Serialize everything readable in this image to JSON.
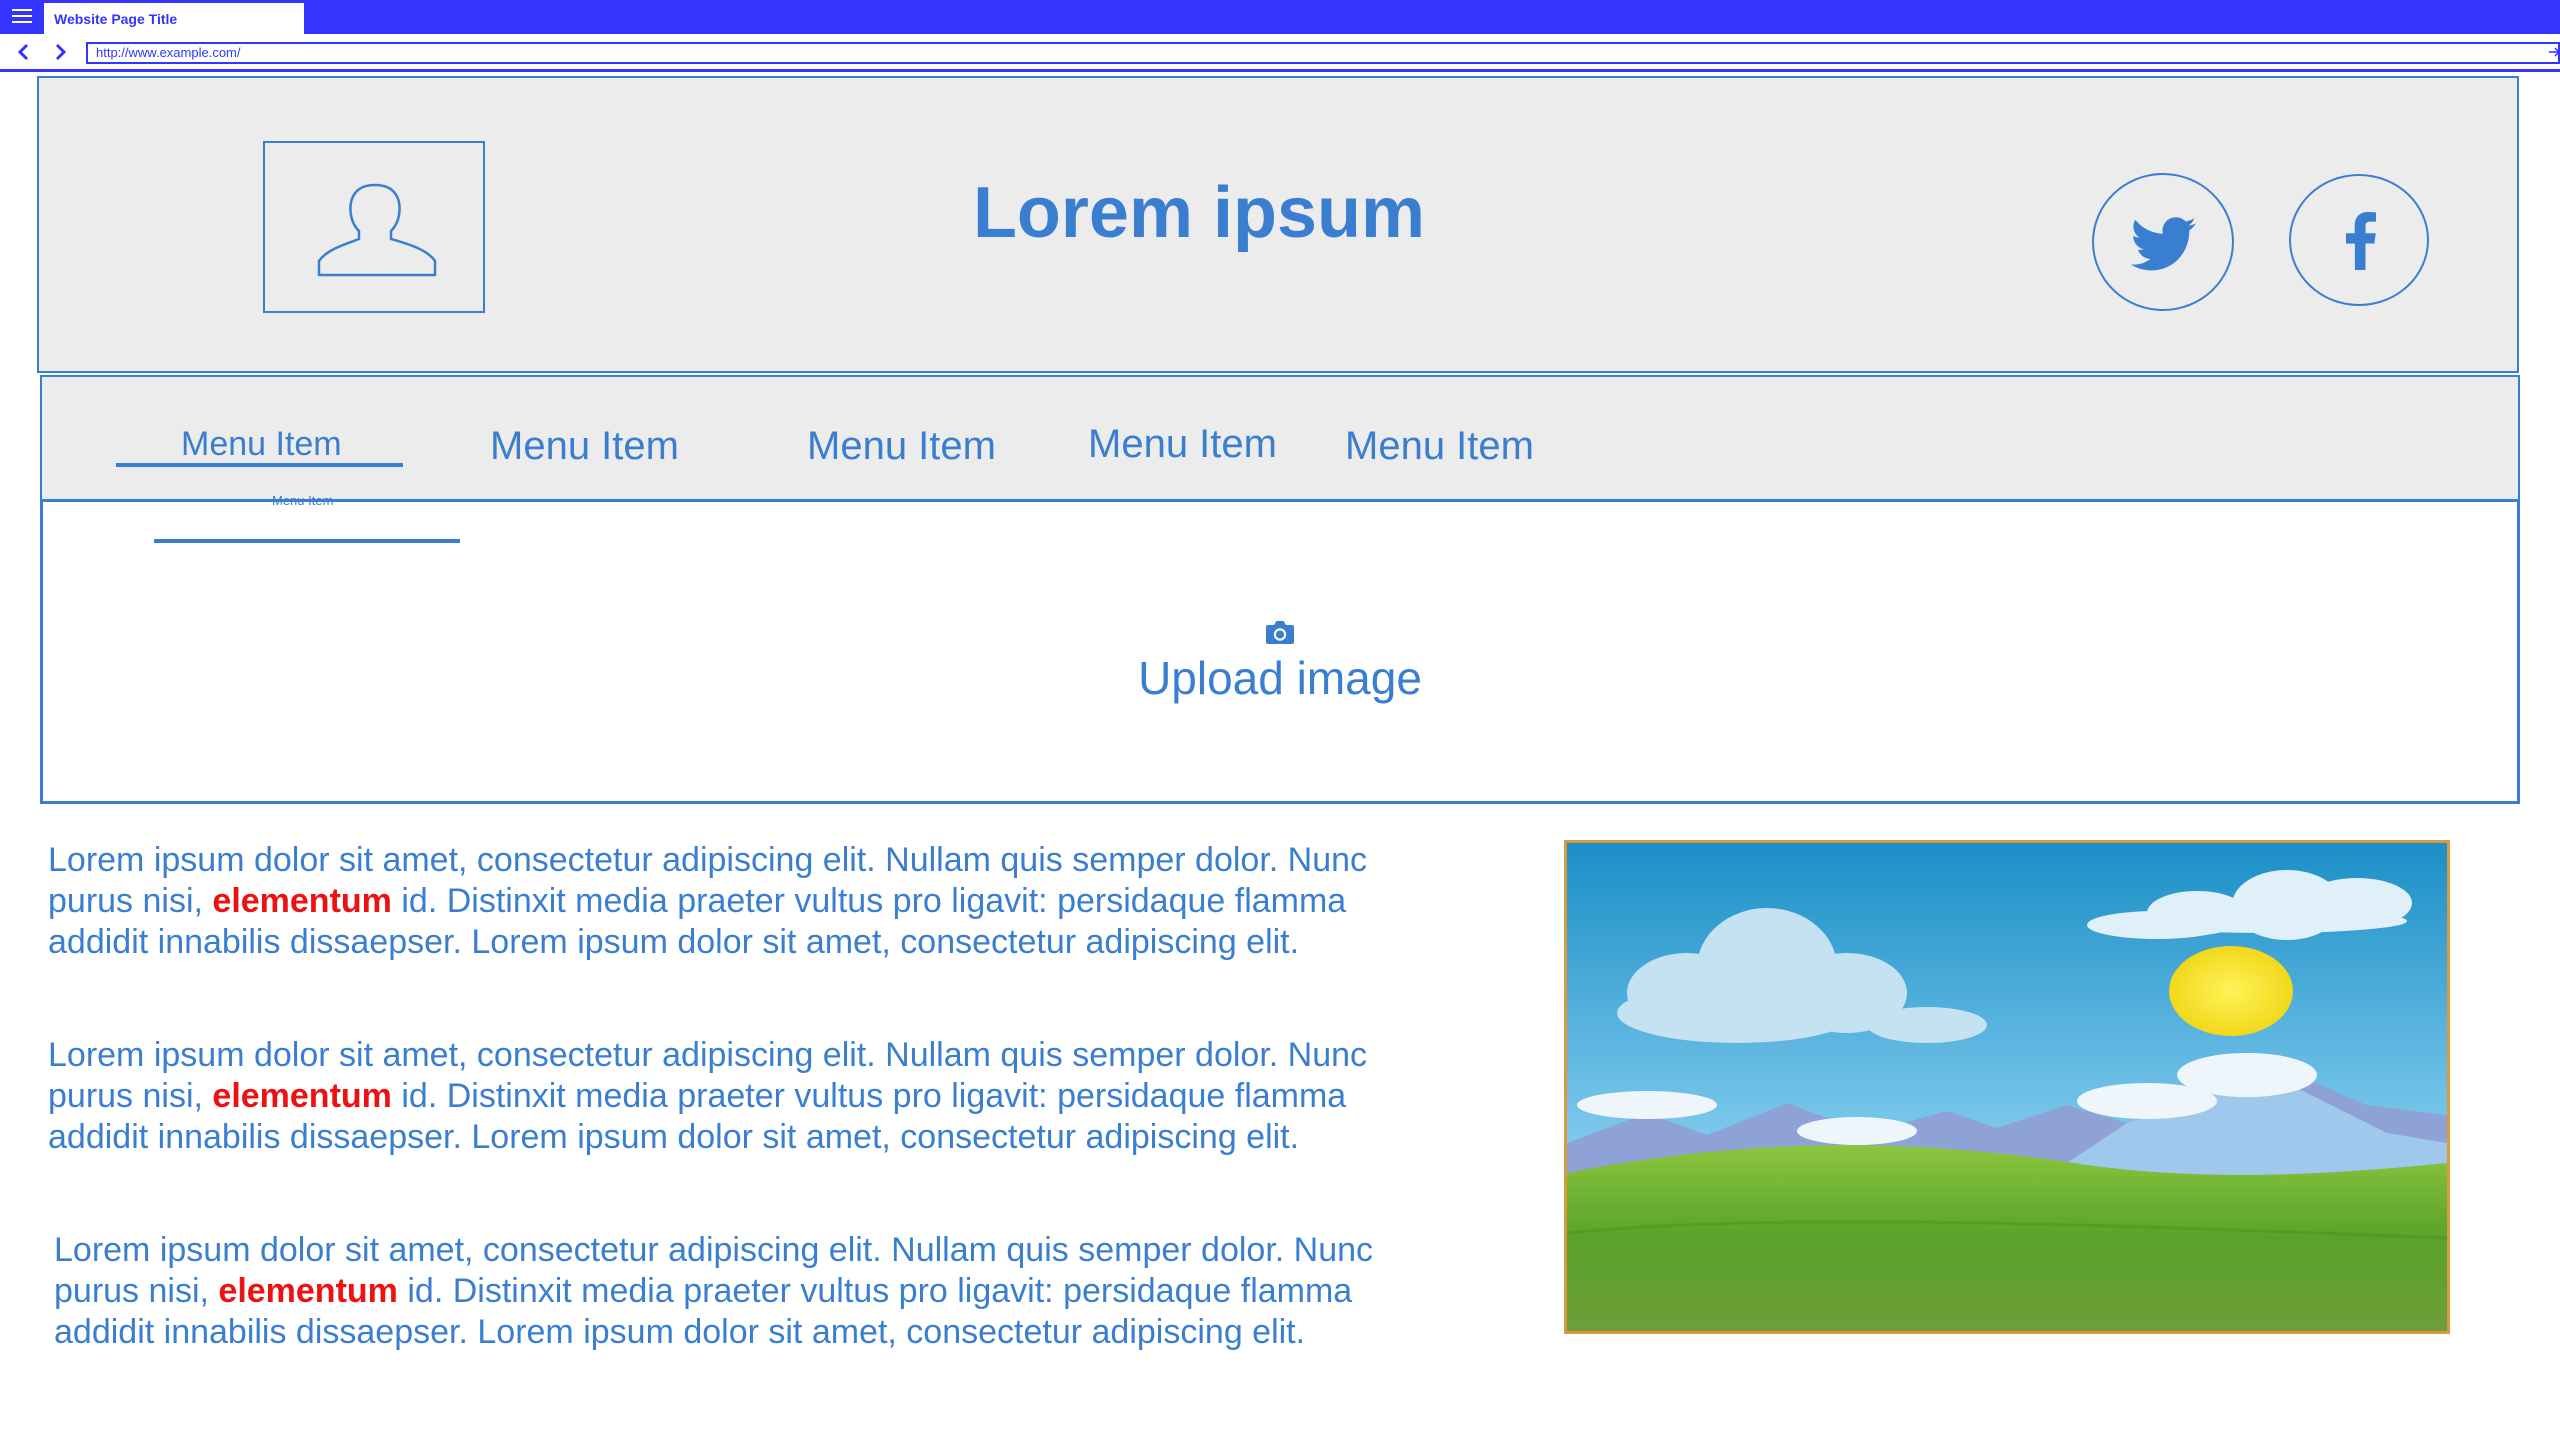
{
  "browser": {
    "tab_title": "Website Page Title",
    "url": "http://www.example.com/"
  },
  "header": {
    "title": "Lorem ipsum",
    "avatar_icon": "user-silhouette-icon",
    "social": [
      "twitter-icon",
      "facebook-icon"
    ]
  },
  "nav": {
    "items": [
      {
        "label": "Menu Item"
      },
      {
        "label": "Menu Item"
      },
      {
        "label": "Menu Item"
      },
      {
        "label": "Menu Item"
      },
      {
        "label": "Menu Item"
      }
    ],
    "overflow_label": "Menu Item"
  },
  "upload": {
    "label": "Upload image",
    "icon": "camera-icon"
  },
  "content": {
    "paragraphs": [
      {
        "before": "Lorem ipsum dolor sit amet, consectetur adipiscing elit. Nullam quis semper dolor. Nunc purus nisi, ",
        "emphasis": "elementum",
        "after": " id. Distinxit  media praeter vultus pro ligavit: persidaque flamma addidit innabilis dissaepser. Lorem ipsum dolor sit amet, consectetur adipiscing elit."
      },
      {
        "before": "Lorem ipsum dolor sit amet, consectetur adipiscing elit. Nullam quis semper dolor. Nunc purus nisi, ",
        "emphasis": "elementum",
        "after": " id. Distinxit  media praeter vultus pro ligavit: persidaque flamma addidit innabilis dissaepser. Lorem ipsum dolor sit amet, consectetur adipiscing elit."
      },
      {
        "before": "Lorem ipsum dolor sit amet, consectetur adipiscing elit. Nullam quis semper dolor. Nunc purus nisi, ",
        "emphasis": "elementum",
        "after": " id. Distinxit  media praeter vultus pro ligavit: persidaque flamma addidit innabilis dissaepser. Lorem ipsum dolor sit amet, consectetur adipiscing elit."
      }
    ],
    "image": "landscape-image"
  },
  "colors": {
    "chrome": "#3434ff",
    "accent": "#3a7fcf",
    "emphasis": "#ee1111",
    "panel": "#ececec",
    "image_border": "#d89a3a"
  }
}
